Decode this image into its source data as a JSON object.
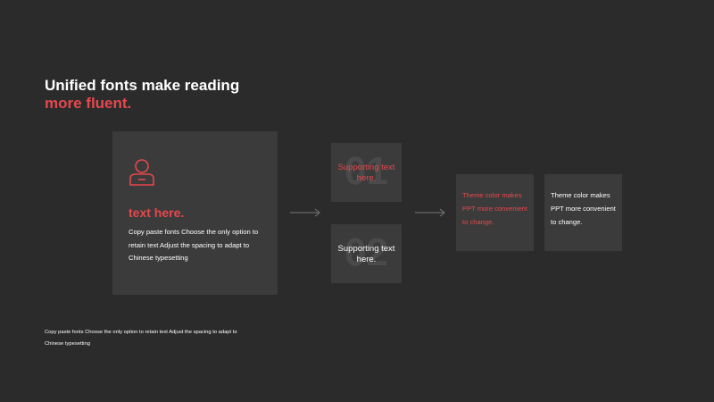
{
  "title": {
    "line1": "Unified fonts make reading",
    "line2": "more fluent."
  },
  "main_card": {
    "icon": "user-icon",
    "heading": "text here.",
    "body": "Copy paste fonts Choose the only option to retain text Adjust the spacing to adapt to Chinese typesetting"
  },
  "cards": [
    {
      "number": "01",
      "text": "Supporting text here.",
      "color": "#e5484d"
    },
    {
      "number": "02",
      "text": "Supporting text here.",
      "color": "#ffffff"
    }
  ],
  "theme_cards": [
    {
      "text": "Theme  color makes PPT more convenient to change.",
      "color": "#e5484d"
    },
    {
      "text": "Theme  color makes PPT more convenient to change.",
      "color": "#ffffff"
    }
  ],
  "footer": "Copy paste fonts Choose the only option to retain text Adjust the spacing to adapt to Chinese typesetting",
  "colors": {
    "accent": "#e5484d",
    "background": "#2b2b2b",
    "card": "#3b3b3b"
  }
}
